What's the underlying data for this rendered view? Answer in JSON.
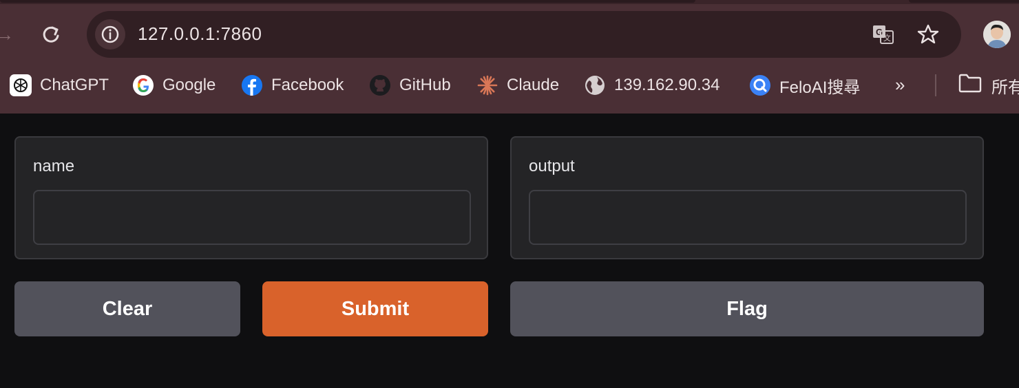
{
  "browser": {
    "url": "127.0.0.1:7860",
    "bookmarks": [
      {
        "label": "ChatGPT",
        "icon": "chatgpt-icon"
      },
      {
        "label": "Google",
        "icon": "google-icon"
      },
      {
        "label": "Facebook",
        "icon": "facebook-icon"
      },
      {
        "label": "GitHub",
        "icon": "github-icon"
      },
      {
        "label": "Claude",
        "icon": "claude-icon"
      },
      {
        "label": "139.162.90.34",
        "icon": "globe-icon"
      },
      {
        "label": "FeloAI搜尋",
        "icon": "feloai-icon"
      }
    ],
    "overflow_label": "»",
    "folder_label": "所有"
  },
  "form": {
    "input_label": "name",
    "input_value": "",
    "output_label": "output",
    "output_value": "",
    "clear_label": "Clear",
    "submit_label": "Submit",
    "flag_label": "Flag"
  },
  "colors": {
    "chrome": "#4a2f35",
    "page_bg": "#0f0f11",
    "panel_bg": "#242426",
    "submit": "#d9622b",
    "secondary_button": "#52525b"
  }
}
